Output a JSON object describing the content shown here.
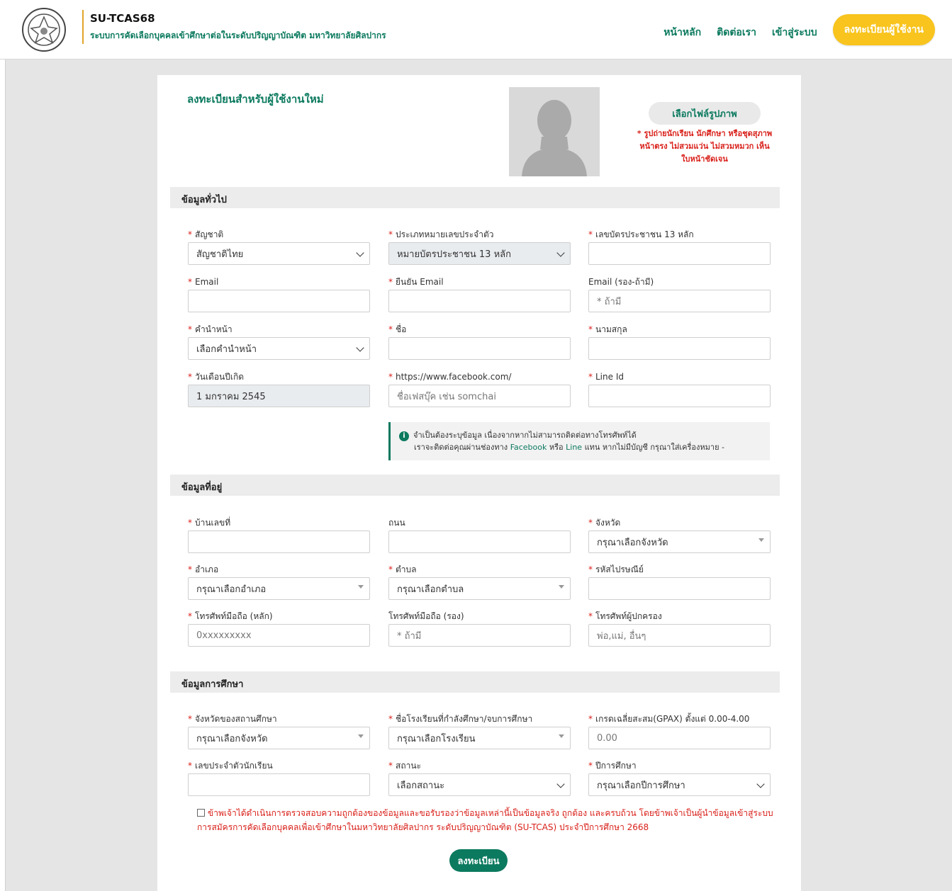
{
  "header": {
    "title": "SU-TCAS68",
    "subtitle": "ระบบการคัดเลือกบุคคลเข้าศึกษาต่อในระดับปริญญาบัณฑิต มหาวิทยาลัยศิลปากร",
    "nav": [
      "หน้าหลัก",
      "ติดต่อเรา",
      "เข้าสู่ระบบ"
    ],
    "cta": "ลงทะเบียนผู้ใช้งาน"
  },
  "page": {
    "title": "ลงทะเบียนสำหรับผู้ใช้งานใหม่",
    "file_button": "เลือกไฟล์รูปภาพ",
    "photo_note": "* รูปถ่ายนักเรียน นักศึกษา หรือชุดสุภาพ หน้าตรง ไม่สวมแว่น ไม่สวมหมวก เห็นใบหน้าชัดเจน"
  },
  "sections": {
    "general": "ข้อมูลทั่วไป",
    "address": "ข้อมูลที่อยู่",
    "education": "ข้อมูลการศึกษา"
  },
  "fields": {
    "nationality": {
      "label": "สัญชาติ",
      "value": "สัญชาติไทย"
    },
    "id_type": {
      "label": "ประเภทหมายเลขประจำตัว",
      "value": "หมายบัตรประชาชน 13 หลัก"
    },
    "id_number": {
      "label": "เลขบัตรประชาชน 13 หลัก",
      "value": ""
    },
    "email": {
      "label": "Email",
      "value": ""
    },
    "email_confirm": {
      "label": "ยืนยัน Email",
      "value": ""
    },
    "email_alt": {
      "label": "Email (รอง-ถ้ามี)",
      "placeholder": "* ถ้ามี"
    },
    "prefix": {
      "label": "คำนำหน้า",
      "value": "เลือกคำนำหน้า"
    },
    "first_name": {
      "label": "ชื่อ",
      "value": ""
    },
    "last_name": {
      "label": "นามสกุล",
      "value": ""
    },
    "birthdate": {
      "label": "วันเดือนปีเกิด",
      "value": "1 มกราคม 2545"
    },
    "facebook": {
      "label": "https://www.facebook.com/",
      "placeholder": "ชื่อเฟสบุ๊ค เช่น somchai"
    },
    "line_id": {
      "label": "Line Id",
      "value": ""
    },
    "house_no": {
      "label": "บ้านเลขที่",
      "value": ""
    },
    "road": {
      "label": "ถนน",
      "value": ""
    },
    "province": {
      "label": "จังหวัด",
      "value": "กรุณาเลือกจังหวัด"
    },
    "district": {
      "label": "อำเภอ",
      "value": "กรุณาเลือกอำเภอ"
    },
    "subdistrict": {
      "label": "ตำบล",
      "value": "กรุณาเลือกตำบล"
    },
    "postcode": {
      "label": "รหัสไปรษณีย์",
      "value": ""
    },
    "mobile_main": {
      "label": "โทรศัพท์มือถือ (หลัก)",
      "placeholder": "0xxxxxxxxx"
    },
    "mobile_alt": {
      "label": "โทรศัพท์มือถือ (รอง)",
      "placeholder": "* ถ้ามี"
    },
    "guardian_phone": {
      "label": "โทรศัพท์ผู้ปกครอง",
      "placeholder": "พ่อ,แม่, อื่นๆ"
    },
    "school_province": {
      "label": "จังหวัดของสถานศึกษา",
      "value": "กรุณาเลือกจังหวัด"
    },
    "school_name": {
      "label": "ชื่อโรงเรียนที่กำลังศึกษา/จบการศึกษา",
      "value": "กรุณาเลือกโรงเรียน"
    },
    "gpax": {
      "label": "เกรดเฉลี่ยสะสม(GPAX) ตั้งแต่ 0.00-4.00",
      "placeholder": "0.00"
    },
    "student_id": {
      "label": "เลขประจำตัวนักเรียน",
      "value": ""
    },
    "status": {
      "label": "สถานะ",
      "value": "เลือกสถานะ"
    },
    "academic_year": {
      "label": "ปีการศึกษา",
      "value": "กรุณาเลือกปีการศึกษา"
    }
  },
  "note": {
    "line1": "จำเป็นต้องระบุข้อมูล เนื่องจากหากไม่สามารถติดต่อทางโทรศัพท์ได้",
    "line2_a": "เราจะติดต่อคุณผ่านช่องทาง",
    "facebook": "Facebook",
    "or": "หรือ",
    "line": "Line",
    "line2_b": "แทน หากไม่มีบัญชี กรุณาใส่เครื่องหมาย -"
  },
  "consent": "ข้าพเจ้าได้ดำเนินการตรวจสอบความถูกต้องของข้อมูลและขอรับรองว่าข้อมูลเหล่านี้เป็นข้อมูลจริง ถูกต้อง และครบถ้วน โดยข้าพเจ้าเป็นผู้นำข้อมูลเข้าสู่ระบบการสมัครการคัดเลือกบุคคลเพื่อเข้าศึกษาในมหาวิทยาลัยศิลปากร ระดับปริญญาบัณฑิต (SU-TCAS) ประจำปีการศึกษา 2668",
  "submit": "ลงทะเบียน",
  "colors": {
    "brand": "#0c7a5f",
    "accent": "#f8c41d",
    "required": "#d9201a"
  }
}
